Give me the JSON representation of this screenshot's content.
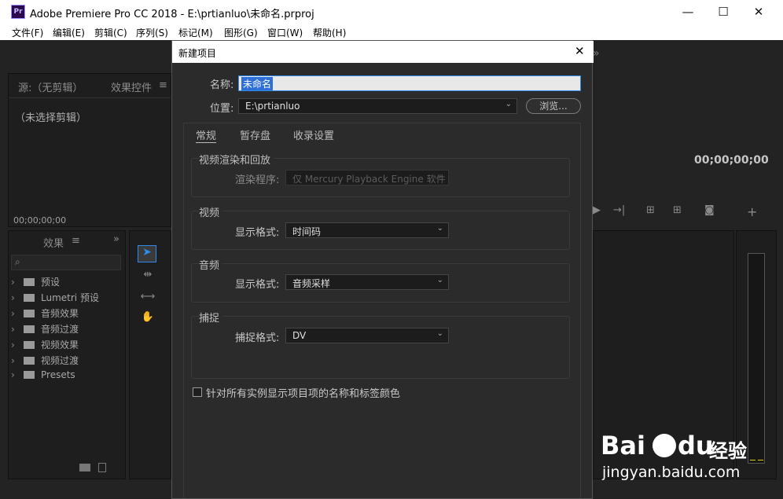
{
  "window": {
    "app_icon": "Pr",
    "title": "Adobe Premiere Pro CC 2018 - E:\\prtianluo\\未命名.prproj",
    "minimize": "—",
    "maximize": "☐",
    "close": "✕"
  },
  "menu": [
    "文件(F)",
    "编辑(E)",
    "剪辑(C)",
    "序列(S)",
    "标记(M)",
    "图形(G)",
    "窗口(W)",
    "帮助(H)"
  ],
  "source_panel": {
    "tab_source": "源:（无剪辑）",
    "tab_effect_controls": "效果控件",
    "tab_menu": "≡",
    "no_clip": "（未选择剪辑）",
    "timecode": "00;00;00;00"
  },
  "effects_panel": {
    "tab": "效果",
    "tab_menu": "≡",
    "overflow": "»",
    "items": [
      {
        "label": "预设",
        "icon": "preset-folder-icon"
      },
      {
        "label": "Lumetri 预设",
        "icon": "preset-folder-icon"
      },
      {
        "label": "音频效果",
        "icon": "folder-icon"
      },
      {
        "label": "音频过渡",
        "icon": "folder-icon"
      },
      {
        "label": "视频效果",
        "icon": "folder-icon"
      },
      {
        "label": "视频过渡",
        "icon": "folder-icon"
      },
      {
        "label": "Presets",
        "icon": "preset-folder-icon"
      }
    ]
  },
  "program_monitor": {
    "timecode": "00;00;00;00",
    "overflow": "»"
  },
  "dialog": {
    "title": "新建项目",
    "close": "✕",
    "name_label": "名称:",
    "name_value": "未命名",
    "location_label": "位置:",
    "location_value": "E:\\prtianluo",
    "browse_button": "浏览...",
    "tabs": [
      "常规",
      "暂存盘",
      "收录设置"
    ],
    "video_rendering": {
      "title": "视频渲染和回放",
      "renderer_label": "渲染程序:",
      "renderer_value": "仅 Mercury Playback Engine 软件"
    },
    "video": {
      "title": "视频",
      "format_label": "显示格式:",
      "format_value": "时间码"
    },
    "audio": {
      "title": "音频",
      "format_label": "显示格式:",
      "format_value": "音频采样"
    },
    "capture": {
      "title": "捕捉",
      "format_label": "捕捉格式:",
      "format_value": "DV"
    },
    "checkbox_label": "针对所有实例显示项目项的名称和标签颜色"
  },
  "watermark": {
    "brand": "Bai",
    "brand2": "du",
    "suffix": "经验",
    "url": "jingyan.baidu.com"
  }
}
